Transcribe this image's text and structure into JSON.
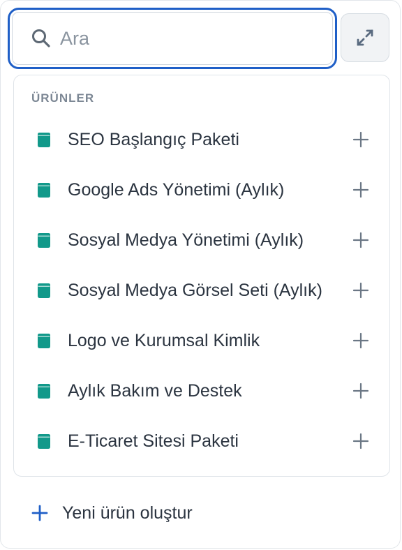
{
  "search": {
    "placeholder": "Ara",
    "value": "",
    "icon": "search-icon"
  },
  "expand_button": {
    "icon": "expand-icon"
  },
  "products_section": {
    "title": "ÜRÜNLER",
    "item_icon": "product-box-icon",
    "item_icon_color": "#12998a",
    "add_icon": "plus-icon",
    "items": [
      {
        "label": "SEO Başlangıç Paketi"
      },
      {
        "label": "Google Ads Yönetimi (Aylık)"
      },
      {
        "label": "Sosyal Medya Yönetimi (Aylık)"
      },
      {
        "label": "Sosyal Medya Görsel Seti (Aylık)"
      },
      {
        "label": "Logo ve Kurumsal Kimlik"
      },
      {
        "label": "Aylık Bakım ve Destek"
      },
      {
        "label": "E-Ticaret Sitesi Paketi"
      }
    ]
  },
  "footer": {
    "create_label": "Yeni ürün oluştur",
    "create_icon": "plus-icon",
    "accent_color": "#1f5fc7"
  },
  "colors": {
    "focus_ring": "#1f5fc7",
    "text": "#2b3440",
    "muted": "#7c8794"
  }
}
